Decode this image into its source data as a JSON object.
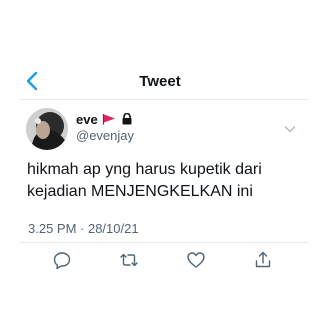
{
  "header": {
    "title": "Tweet",
    "back_icon": "chevron-left-icon"
  },
  "tweet": {
    "author": {
      "display_name": "eve",
      "handle": "@evenjay",
      "badges": [
        "flag-icon",
        "lock-icon"
      ]
    },
    "text": "hikmah ap yng harus kupetik dari\nkejadian MENJENGKELKAN ini",
    "timestamp": "3.25 PM · 28/10/21",
    "actions": [
      "reply-icon",
      "retweet-icon",
      "like-icon",
      "share-icon"
    ]
  },
  "colors": {
    "accent": "#1d9bf0",
    "text": "#0f1419",
    "secondary": "#536471",
    "divider": "#e6ecf0",
    "flag": "#e0245e"
  }
}
